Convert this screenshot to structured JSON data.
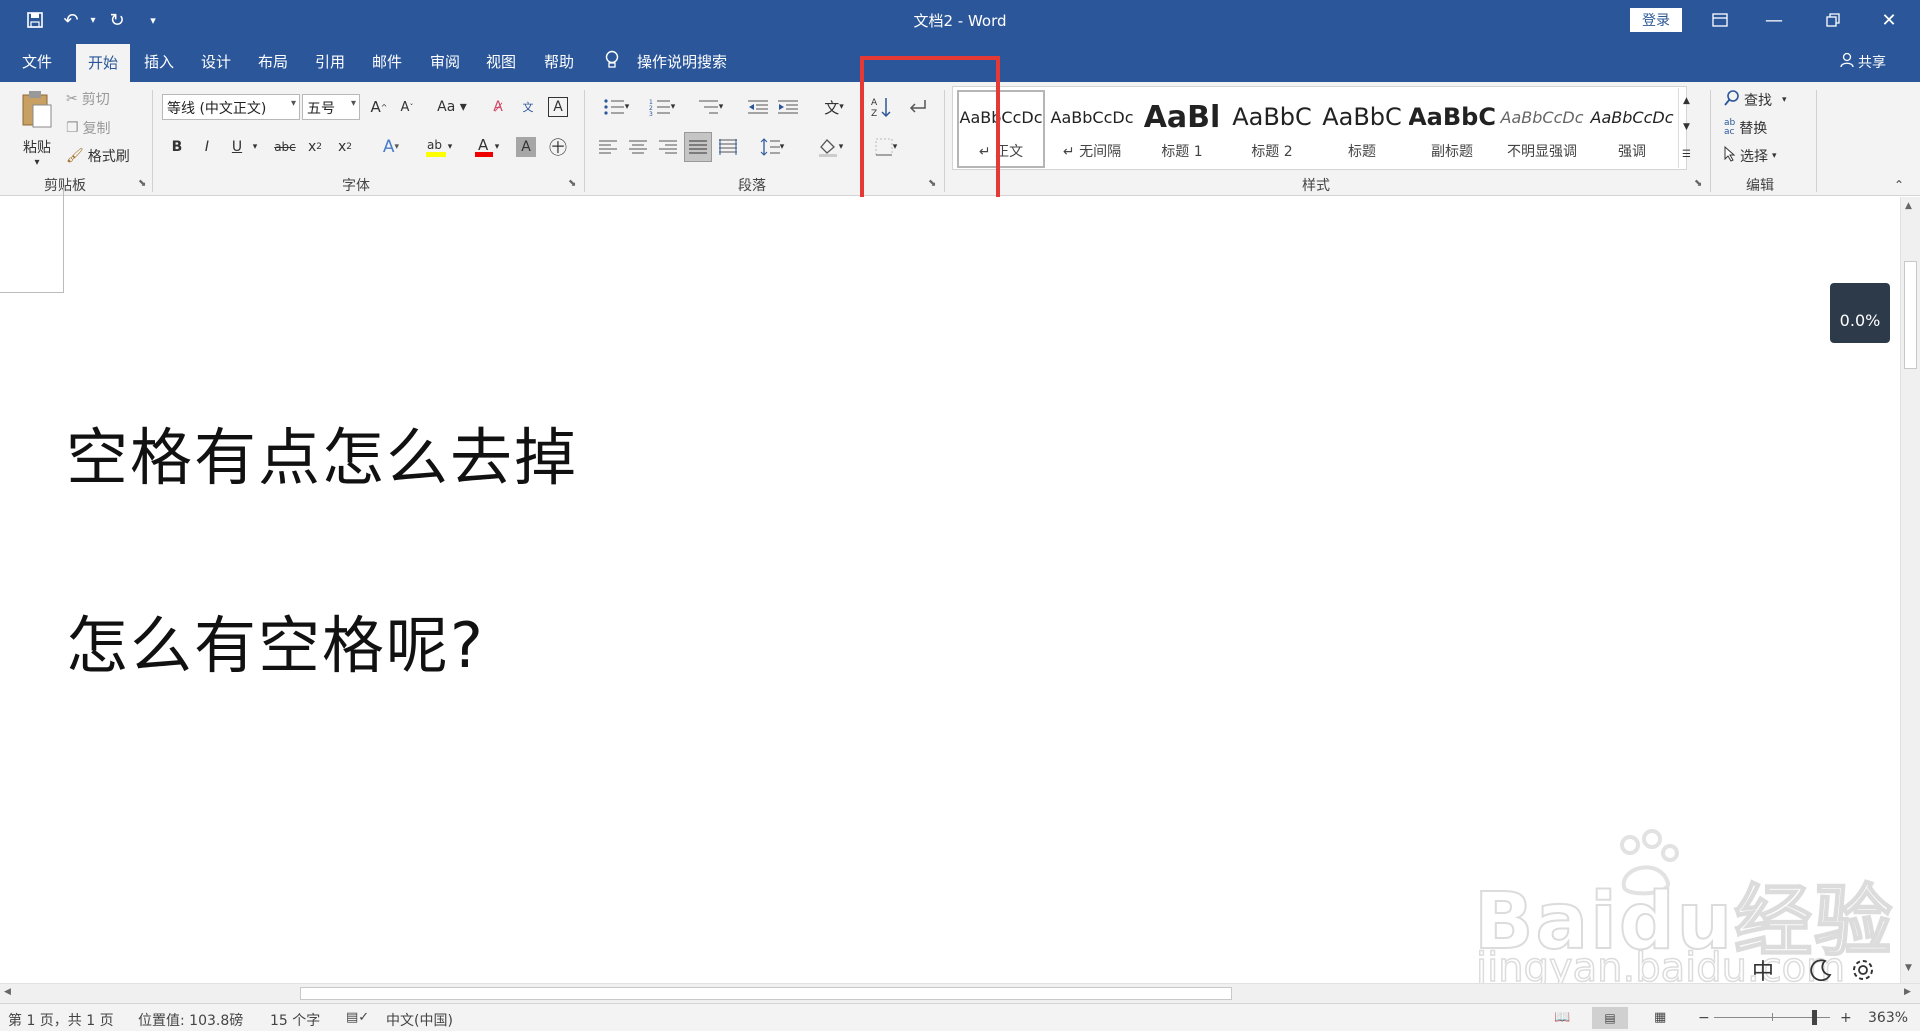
{
  "window": {
    "title": "文档2  -  Word",
    "login": "登录"
  },
  "tabs": [
    "文件",
    "开始",
    "插入",
    "设计",
    "布局",
    "引用",
    "邮件",
    "审阅",
    "视图",
    "帮助"
  ],
  "active_tab": "开始",
  "tell_me": "操作说明搜索",
  "share": "共享",
  "clipboard": {
    "paste": "粘贴",
    "cut": "剪切",
    "copy": "复制",
    "format_painter": "格式刷",
    "label": "剪贴板"
  },
  "font": {
    "name": "等线 (中文正文)",
    "size": "五号",
    "label": "字体"
  },
  "paragraph": {
    "label": "段落"
  },
  "styles": {
    "label": "样式",
    "items": [
      {
        "sample": "AaBbCcDc",
        "name": "正文"
      },
      {
        "sample": "AaBbCcDc",
        "name": "无间隔"
      },
      {
        "sample": "AaBl",
        "name": "标题 1"
      },
      {
        "sample": "AaBbC",
        "name": "标题 2"
      },
      {
        "sample": "AaBbC",
        "name": "标题"
      },
      {
        "sample": "AaBbC",
        "name": "副标题"
      },
      {
        "sample": "AaBbCcDc",
        "name": "不明显强调"
      },
      {
        "sample": "AaBbCcDc",
        "name": "强调"
      }
    ]
  },
  "editing": {
    "find": "查找",
    "replace": "替换",
    "select": "选择",
    "label": "编辑"
  },
  "document": {
    "lines": [
      "空格有点怎么去掉",
      "怎么有空格呢?"
    ]
  },
  "progress_badge": "0.0%",
  "watermark": {
    "brand": "Baidu经验",
    "url": "jingyan.baidu.com"
  },
  "status": {
    "page": "第 1 页，共 1 页",
    "position": "位置值: 103.8磅",
    "words": "15 个字",
    "language": "中文(中国)",
    "zoom": "363%"
  },
  "colors": {
    "brand": "#2b579a",
    "highlight_box": "#e53935"
  }
}
